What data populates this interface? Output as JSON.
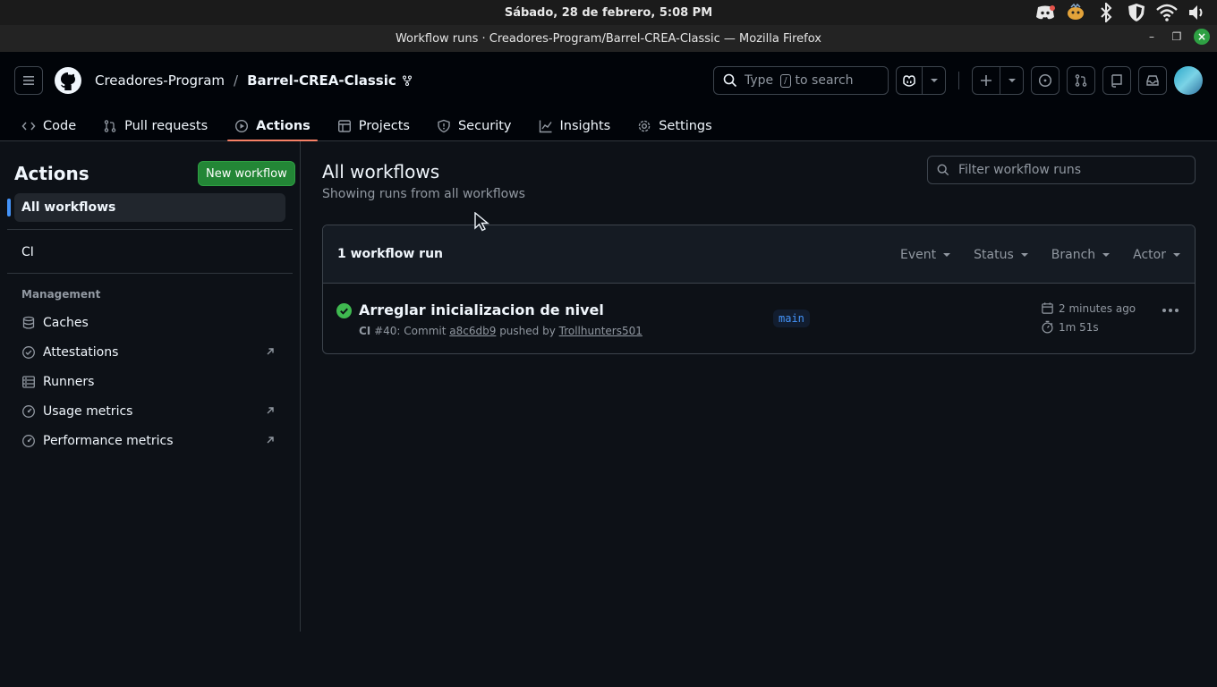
{
  "os": {
    "clock": "Sábado, 28 de febrero, 5:08 PM",
    "tray_icons": [
      "discord-icon",
      "tray-app-icon",
      "bluetooth-icon",
      "shield-icon",
      "wifi-icon",
      "volume-icon"
    ]
  },
  "window": {
    "title": "Workflow runs · Creadores-Program/Barrel-CREA-Classic — Mozilla Firefox"
  },
  "header": {
    "owner": "Creadores-Program",
    "separator": "/",
    "repo": "Barrel-CREA-Classic",
    "search_prefix": "Type",
    "search_key": "/",
    "search_suffix": "to search"
  },
  "tabs": [
    {
      "label": "Code",
      "icon": "code-icon"
    },
    {
      "label": "Pull requests",
      "icon": "pull-request-icon"
    },
    {
      "label": "Actions",
      "icon": "play-icon",
      "active": true
    },
    {
      "label": "Projects",
      "icon": "table-icon"
    },
    {
      "label": "Security",
      "icon": "shield-icon"
    },
    {
      "label": "Insights",
      "icon": "graph-icon"
    },
    {
      "label": "Settings",
      "icon": "gear-icon"
    }
  ],
  "sidebar": {
    "title": "Actions",
    "new_workflow": "New workflow",
    "all_workflows": "All workflows",
    "workflows": [
      "CI"
    ],
    "section": "Management",
    "management": [
      {
        "label": "Caches",
        "icon": "database-icon"
      },
      {
        "label": "Attestations",
        "icon": "verified-icon"
      },
      {
        "label": "Runners",
        "icon": "server-icon"
      },
      {
        "label": "Usage metrics",
        "icon": "meter-icon"
      },
      {
        "label": "Performance metrics",
        "icon": "meter-icon"
      }
    ]
  },
  "content": {
    "title": "All workflows",
    "subtitle": "Showing runs from all workflows",
    "filter_placeholder": "Filter workflow runs",
    "run_count": "1 workflow run",
    "filters": [
      "Event",
      "Status",
      "Branch",
      "Actor"
    ],
    "run": {
      "title": "Arreglar inicializacion de nivel",
      "workflow": "CI",
      "number_text": "#40: Commit",
      "commit": "a8c6db9",
      "pushed_by_text": "pushed by",
      "actor": "Trollhunters501",
      "branch": "main",
      "time_ago": "2 minutes ago",
      "duration": "1m 51s"
    }
  }
}
